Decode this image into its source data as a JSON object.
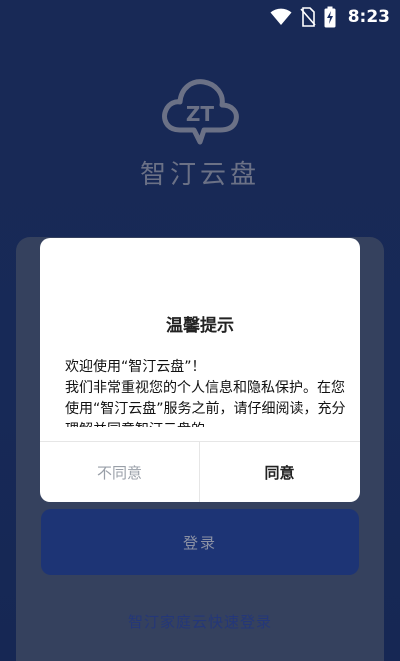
{
  "status_bar": {
    "time": "8:23",
    "icons": [
      "wifi-icon",
      "no-sim-icon",
      "battery-charging-icon"
    ]
  },
  "app": {
    "logo_text": "ZT",
    "name": "智汀云盘"
  },
  "login": {
    "login_button": "登录",
    "family_login_link": "智汀家庭云快速登录"
  },
  "dialog": {
    "title": "温馨提示",
    "body_lines": [
      "欢迎使用“智汀云盘”！",
      "我们非常重视您的个人信息和隐私保护。在您使用“智汀云盘”服务之前，请仔细阅读，充分理解并同意智汀云盘的"
    ],
    "disagree_label": "不同意",
    "agree_label": "同意"
  },
  "colors": {
    "background": "#1b2f63",
    "login_button": "#223c86",
    "card": "#3d4a6b",
    "link": "#2a3f8a"
  }
}
